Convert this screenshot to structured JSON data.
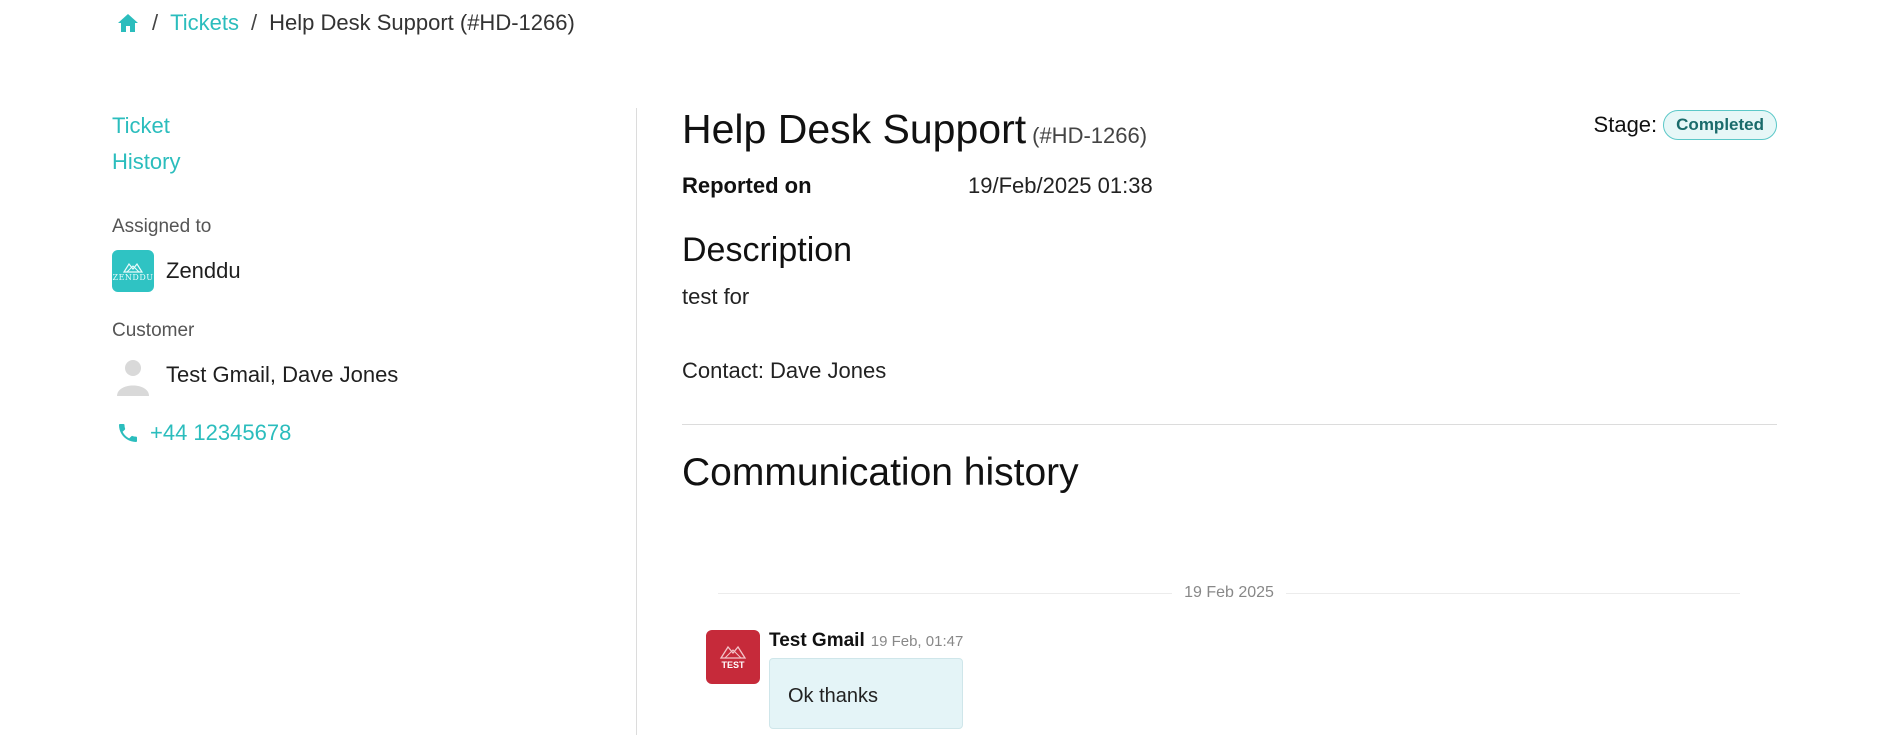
{
  "breadcrumb": {
    "home_icon": "home-icon",
    "separator": "/",
    "tickets_label": "Tickets",
    "current": "Help Desk Support (#HD-1266)"
  },
  "sidebar": {
    "links": {
      "ticket": "Ticket",
      "history": "History"
    },
    "assigned_label": "Assigned to",
    "assignee": {
      "name": "Zenddu",
      "avatar_text": "ZENDDU",
      "avatar_color": "#2fc3c3"
    },
    "customer_label": "Customer",
    "customer": {
      "name": "Test Gmail, Dave Jones"
    },
    "phone": "+44 12345678"
  },
  "ticket": {
    "title": "Help Desk Support",
    "code": "(#HD-1266)",
    "stage_label": "Stage:",
    "stage_value": "Completed",
    "reported_label": "Reported on",
    "reported_value": "19/Feb/2025 01:38",
    "description_title": "Description",
    "description_line": "test for",
    "description_contact": "Contact: Dave Jones"
  },
  "communication": {
    "title": "Communication history",
    "date_divider": "19 Feb 2025",
    "messages": [
      {
        "sender": "Test Gmail",
        "time": "19 Feb, 01:47",
        "text": "Ok thanks",
        "avatar_text": "TEST",
        "avatar_color": "#c62a3a"
      }
    ]
  },
  "colors": {
    "accent": "#2bbdbd",
    "badge_bg": "#e6f7f7"
  }
}
